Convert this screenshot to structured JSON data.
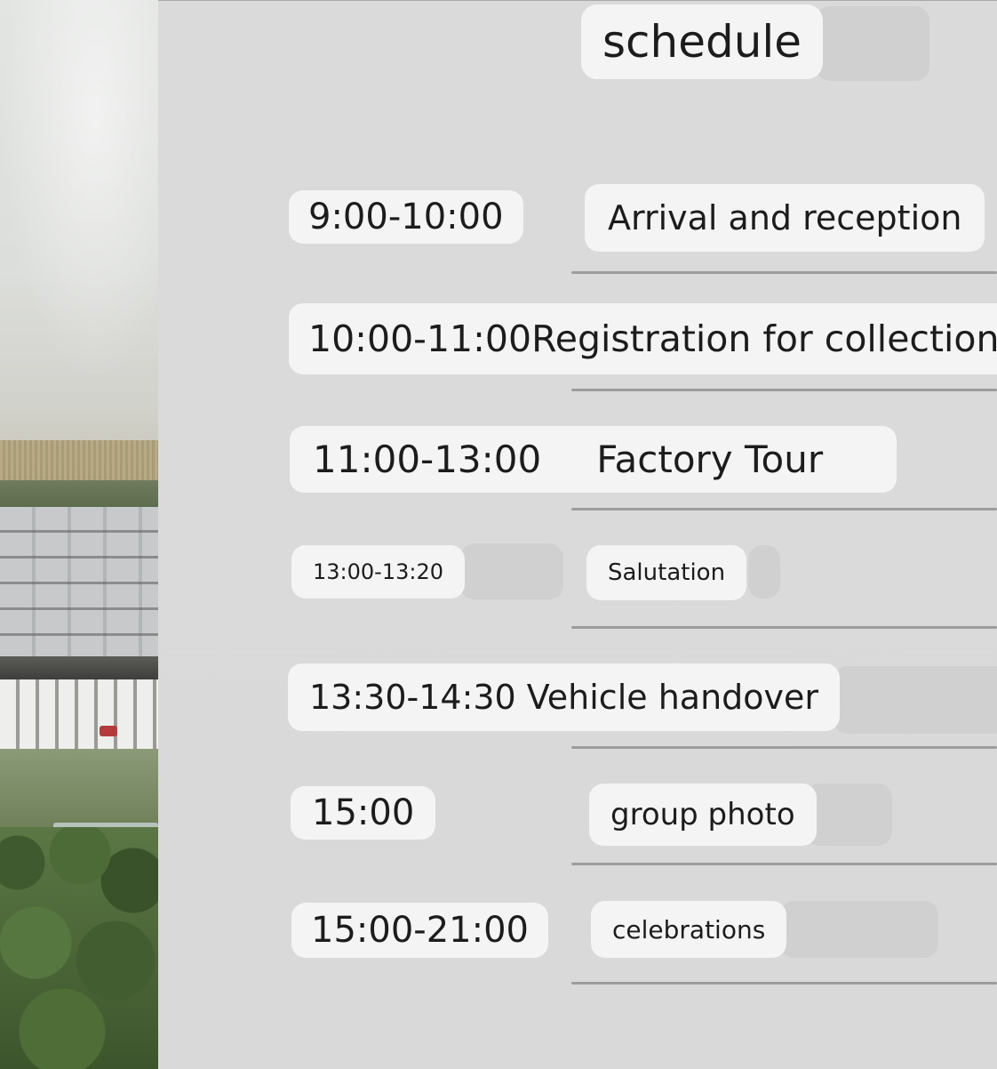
{
  "page": {
    "title": "schedule"
  },
  "schedule": {
    "items": [
      {
        "time": "9:00-10:00",
        "event": "Arrival and reception"
      },
      {
        "time": "10:00-11:00",
        "event": "Registration for collection"
      },
      {
        "time": "11:00-13:00",
        "event": "Factory Tour"
      },
      {
        "time": "13:00-13:20",
        "event": "Salutation"
      },
      {
        "time": "13:30-14:30",
        "event": "Vehicle handover"
      },
      {
        "time": "15:00",
        "event": "group photo"
      },
      {
        "time": "15:00-21:00",
        "event": "celebrations"
      }
    ]
  },
  "colors": {
    "panel_background": "#dadada",
    "pill_background": "#f4f4f4",
    "rule": "#9d9d9d"
  }
}
